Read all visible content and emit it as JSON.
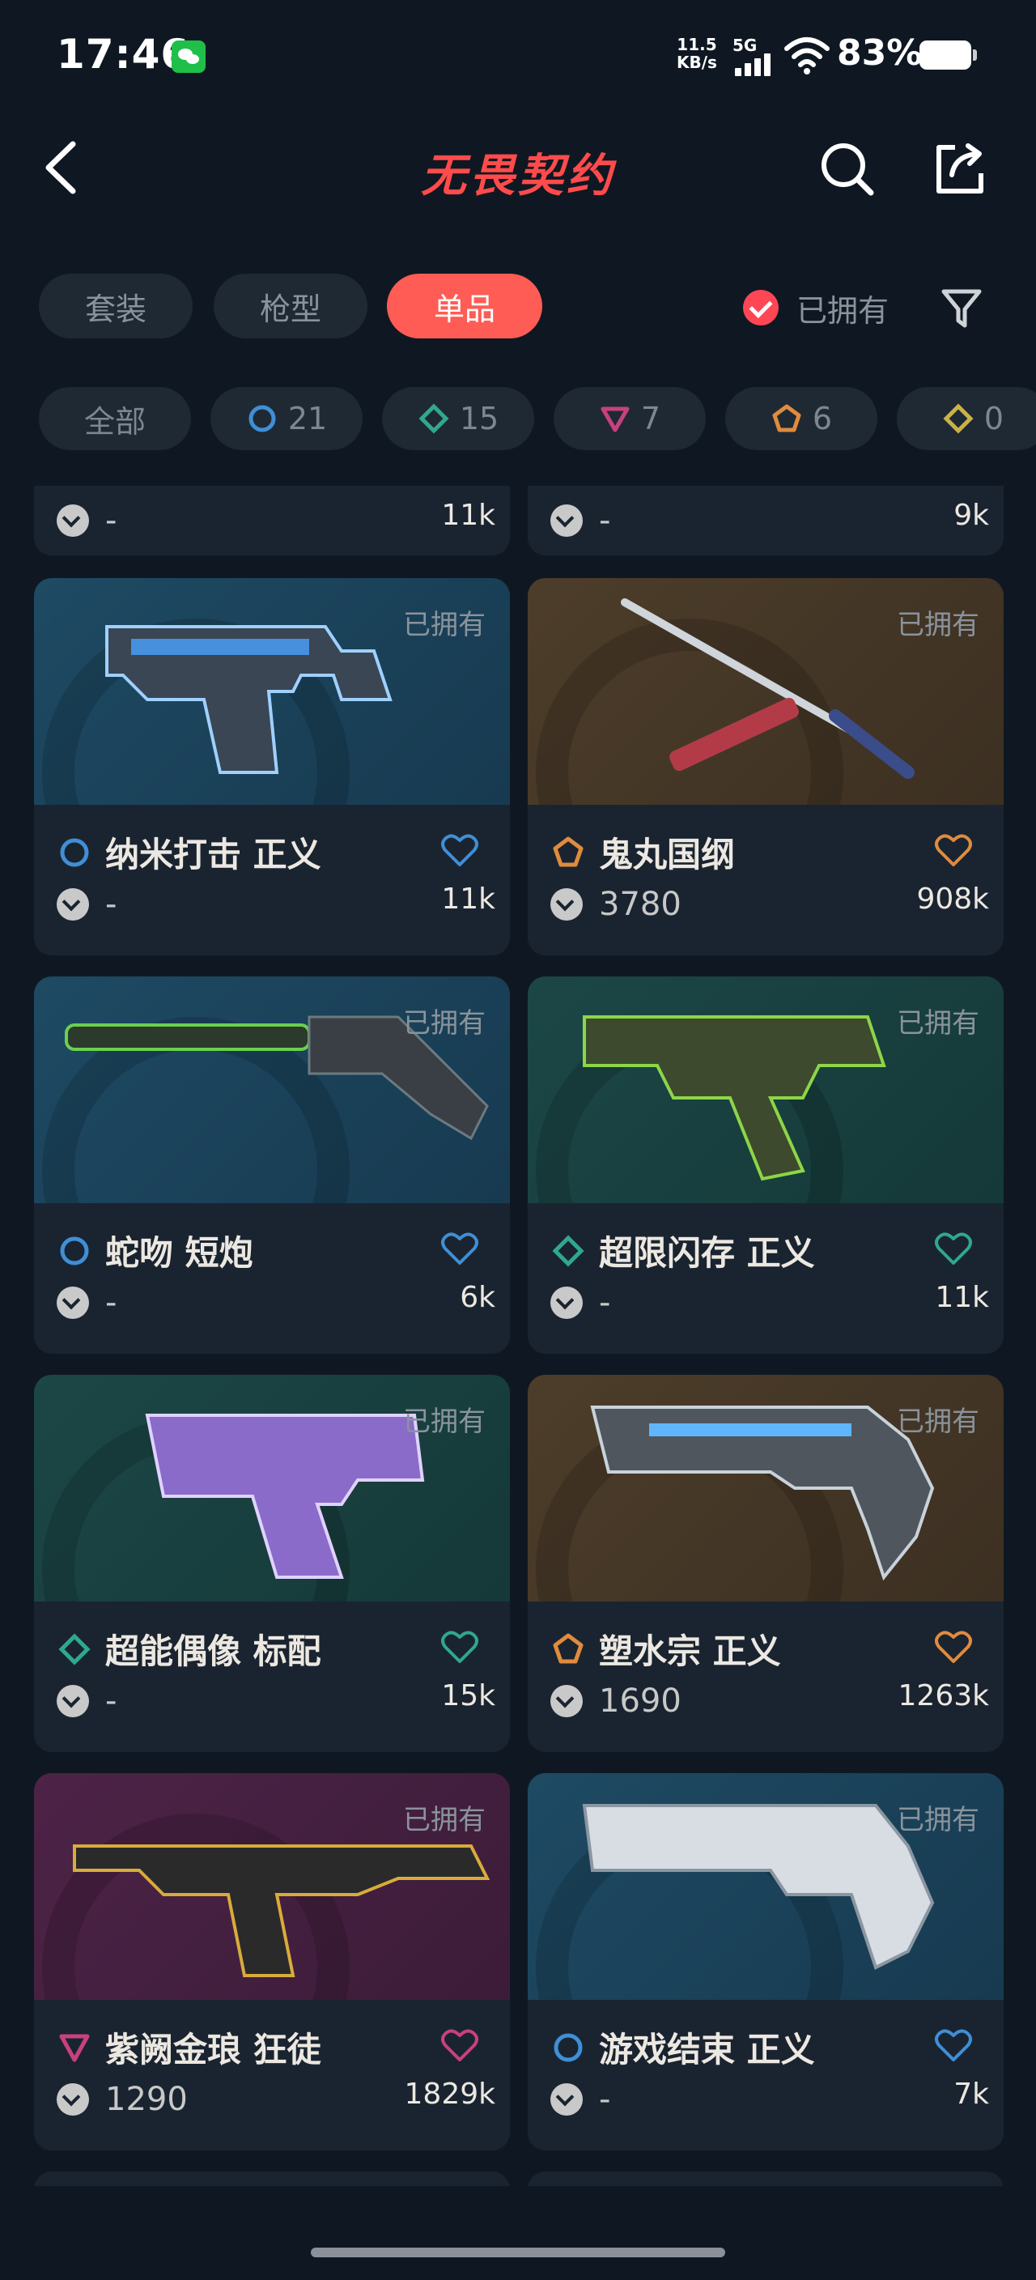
{
  "status": {
    "time": "17:46",
    "net_speed_value": "11.5",
    "net_speed_unit": "KB/s",
    "signal_label": "5G",
    "battery": "83%"
  },
  "header": {
    "title": "无畏契约"
  },
  "tabs": [
    {
      "label": "套装"
    },
    {
      "label": "枪型"
    },
    {
      "label": "单品",
      "active": true
    }
  ],
  "owned_filter": {
    "label": "已拥有",
    "checked": true
  },
  "chips": [
    {
      "label": "全部",
      "icon": "all"
    },
    {
      "label": "21",
      "icon": "select-tier-icon",
      "color": "#3f8fd6"
    },
    {
      "label": "15",
      "icon": "deluxe-tier-icon",
      "color": "#2fa88f"
    },
    {
      "label": "7",
      "icon": "premium-tier-icon",
      "color": "#c8417f"
    },
    {
      "label": "6",
      "icon": "exclusive-tier-icon",
      "color": "#e08b3e"
    },
    {
      "label": "0",
      "icon": "ultra-tier-icon",
      "color": "#c9b24a"
    }
  ],
  "cards": [
    {
      "name": "",
      "tier": "",
      "price": "-",
      "likes": "11k",
      "owned": ""
    },
    {
      "name": "",
      "tier": "",
      "price": "-",
      "likes": "9k",
      "owned": ""
    },
    {
      "name": "纳米打击 正义",
      "tier": "select",
      "tier_color": "#3f8fd6",
      "price": "-",
      "likes": "11k",
      "owned": "已拥有",
      "bg": "blue"
    },
    {
      "name": "鬼丸国纲",
      "tier": "exclusive",
      "tier_color": "#e08b3e",
      "price": "3780",
      "likes": "908k",
      "owned": "已拥有",
      "bg": "brown"
    },
    {
      "name": "蛇吻 短炮",
      "tier": "select",
      "tier_color": "#3f8fd6",
      "price": "-",
      "likes": "6k",
      "owned": "已拥有",
      "bg": "blue"
    },
    {
      "name": "超限闪存 正义",
      "tier": "deluxe",
      "tier_color": "#2fa88f",
      "price": "-",
      "likes": "11k",
      "owned": "已拥有",
      "bg": "teal"
    },
    {
      "name": "超能偶像 标配",
      "tier": "deluxe",
      "tier_color": "#2fa88f",
      "price": "-",
      "likes": "15k",
      "owned": "已拥有",
      "bg": "teal"
    },
    {
      "name": "塑水宗 正义",
      "tier": "exclusive",
      "tier_color": "#e08b3e",
      "price": "1690",
      "likes": "1263k",
      "owned": "已拥有",
      "bg": "brown"
    },
    {
      "name": "紫阙金琅 狂徒",
      "tier": "premium",
      "tier_color": "#c8417f",
      "price": "1290",
      "likes": "1829k",
      "owned": "已拥有",
      "bg": "purple"
    },
    {
      "name": "游戏结束 正义",
      "tier": "select",
      "tier_color": "#3f8fd6",
      "price": "-",
      "likes": "7k",
      "owned": "已拥有",
      "bg": "blue"
    }
  ]
}
